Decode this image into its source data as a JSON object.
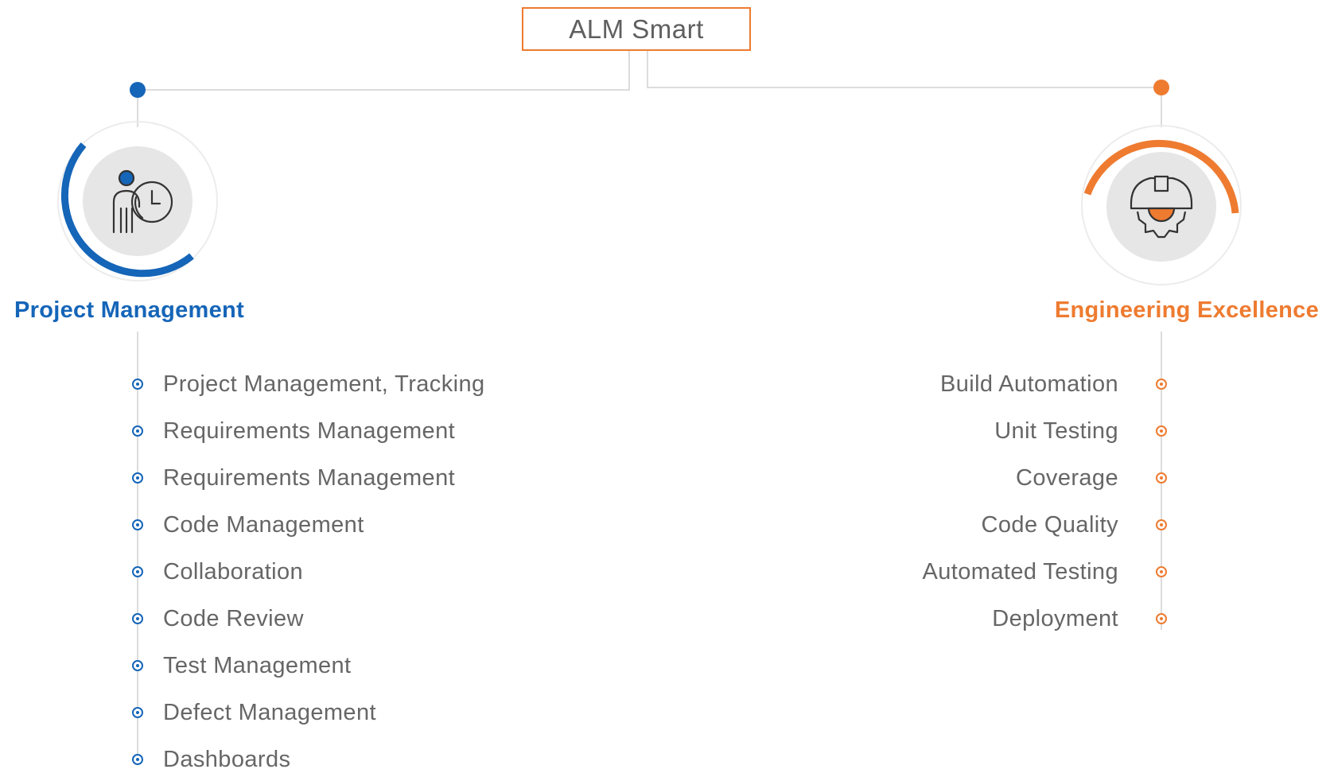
{
  "root": {
    "title": "ALM Smart"
  },
  "colors": {
    "pm": "#1565b8",
    "ee": "#ee7b30",
    "line": "#d9d9d9",
    "text": "#666666"
  },
  "project_management": {
    "heading": "Project Management",
    "icon": "person-clock-icon",
    "items": [
      "Project Management, Tracking",
      "Requirements Management",
      "Requirements Management",
      "Code Management",
      "Collaboration",
      "Code Review",
      "Test Management",
      "Defect Management",
      "Dashboards"
    ]
  },
  "engineering_excellence": {
    "heading": "Engineering Excellence",
    "icon": "hardhat-gear-icon",
    "items": [
      "Build Automation",
      "Unit Testing",
      "Coverage",
      "Code Quality",
      "Automated Testing",
      "Deployment"
    ]
  }
}
